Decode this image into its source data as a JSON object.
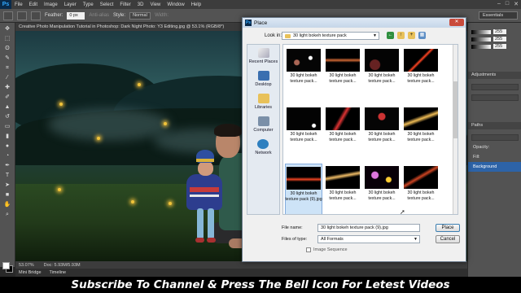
{
  "menubar": {
    "app_logo": "Ps",
    "items": [
      "File",
      "Edit",
      "Image",
      "Layer",
      "Type",
      "Select",
      "Filter",
      "3D",
      "View",
      "Window",
      "Help"
    ]
  },
  "options_bar": {
    "feather_label": "Feather:",
    "feather_value": "0 px",
    "anti_alias_label": "Anti-alias",
    "style_label": "Style:",
    "style_value": "Normal",
    "width_label": "Width:",
    "workspace": "Essentials"
  },
  "document": {
    "tab_title": "Creative Photo Manipulation Tutorial in Photoshop: Dark Night Photo: Y3 Editing.jpg @ 53.1% (RGB/8*)",
    "zoom": "53.07%",
    "doc_size": "Doc: 5.93M/5.93M"
  },
  "bottom_tabs": [
    "Mini Bridge",
    "Timeline"
  ],
  "right_panel": {
    "rgb_values": [
      "255",
      "255",
      "255"
    ],
    "tabs": [
      "Adjustments",
      "Paths"
    ],
    "opacity_label": "Opacity:",
    "fill_label": "Fill:",
    "layer_name": "Background"
  },
  "dialog": {
    "title": "Place",
    "look_in_label": "Look in:",
    "look_in_value": "30 light bokeh texture pack",
    "places": [
      "Recent Places",
      "Desktop",
      "Libraries",
      "Computer",
      "Network"
    ],
    "files": [
      {
        "label": "30 light bokeh texture pack...",
        "selected": false
      },
      {
        "label": "30 light bokeh texture pack...",
        "selected": false
      },
      {
        "label": "30 light bokeh texture pack...",
        "selected": false
      },
      {
        "label": "30 light bokeh texture pack...",
        "selected": false
      },
      {
        "label": "30 light bokeh texture pack...",
        "selected": false
      },
      {
        "label": "30 light bokeh texture pack...",
        "selected": false
      },
      {
        "label": "30 light bokeh texture pack...",
        "selected": false
      },
      {
        "label": "30 light bokeh texture pack...",
        "selected": false
      },
      {
        "label": "30 light bokeh texture pack (9).jpg",
        "selected": true
      },
      {
        "label": "30 light bokeh texture pack...",
        "selected": false
      },
      {
        "label": "30 light bokeh texture pack...",
        "selected": false
      },
      {
        "label": "30 light bokeh texture pack...",
        "selected": false
      }
    ],
    "file_name_label": "File name:",
    "file_name_value": "30 light bokeh texture pack  (9).jpg",
    "files_of_type_label": "Files of type:",
    "files_of_type_value": "All Formats",
    "place_button": "Place",
    "cancel_button": "Cancel",
    "image_sequence_label": "Image Sequence"
  },
  "banner": "Subscribe To Channel & Press The Bell Icon For Letest Videos",
  "colors": {
    "ps_chrome": "#535353",
    "dialog_bg": "#f0f0f0",
    "selection": "#cde3f7",
    "layer_highlight": "#2d63a7",
    "firefly": "#f0c33a"
  }
}
